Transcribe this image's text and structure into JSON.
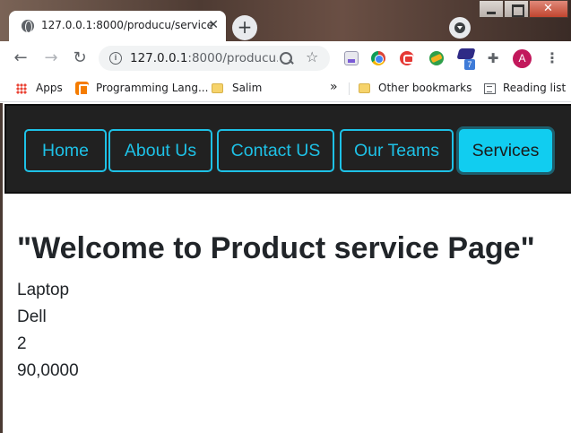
{
  "browser": {
    "tab": {
      "title": "127.0.0.1:8000/producu/service",
      "close_symbol": "✕"
    },
    "new_tab_symbol": "+",
    "address": {
      "host": "127.0.0.1",
      "rest": ":8000/producu..."
    },
    "profile_initial": "A",
    "extension_badge": "7",
    "nav_symbols": {
      "back": "←",
      "forward": "→",
      "reload": "↻",
      "star": "☆",
      "puzzle": "✚",
      "menu": "⋮"
    },
    "bookmarks": {
      "apps": "Apps",
      "programming": "Programming Lang...",
      "salim": "Salim",
      "overflow": "»",
      "other": "Other bookmarks",
      "reading_list": "Reading list"
    }
  },
  "navbar": {
    "links": [
      {
        "label": "Home",
        "active": false
      },
      {
        "label": "About Us",
        "active": false
      },
      {
        "label": "Contact US",
        "active": false
      },
      {
        "label": "Our Teams",
        "active": false
      },
      {
        "label": "Services",
        "active": true
      }
    ],
    "accent_color": "#1ec1e6",
    "background_color": "#212121"
  },
  "page": {
    "heading": "\"Welcome to Product service Page\"",
    "product": {
      "name": "Laptop",
      "brand": "Dell",
      "quantity": "2",
      "price": "90,0000"
    }
  }
}
